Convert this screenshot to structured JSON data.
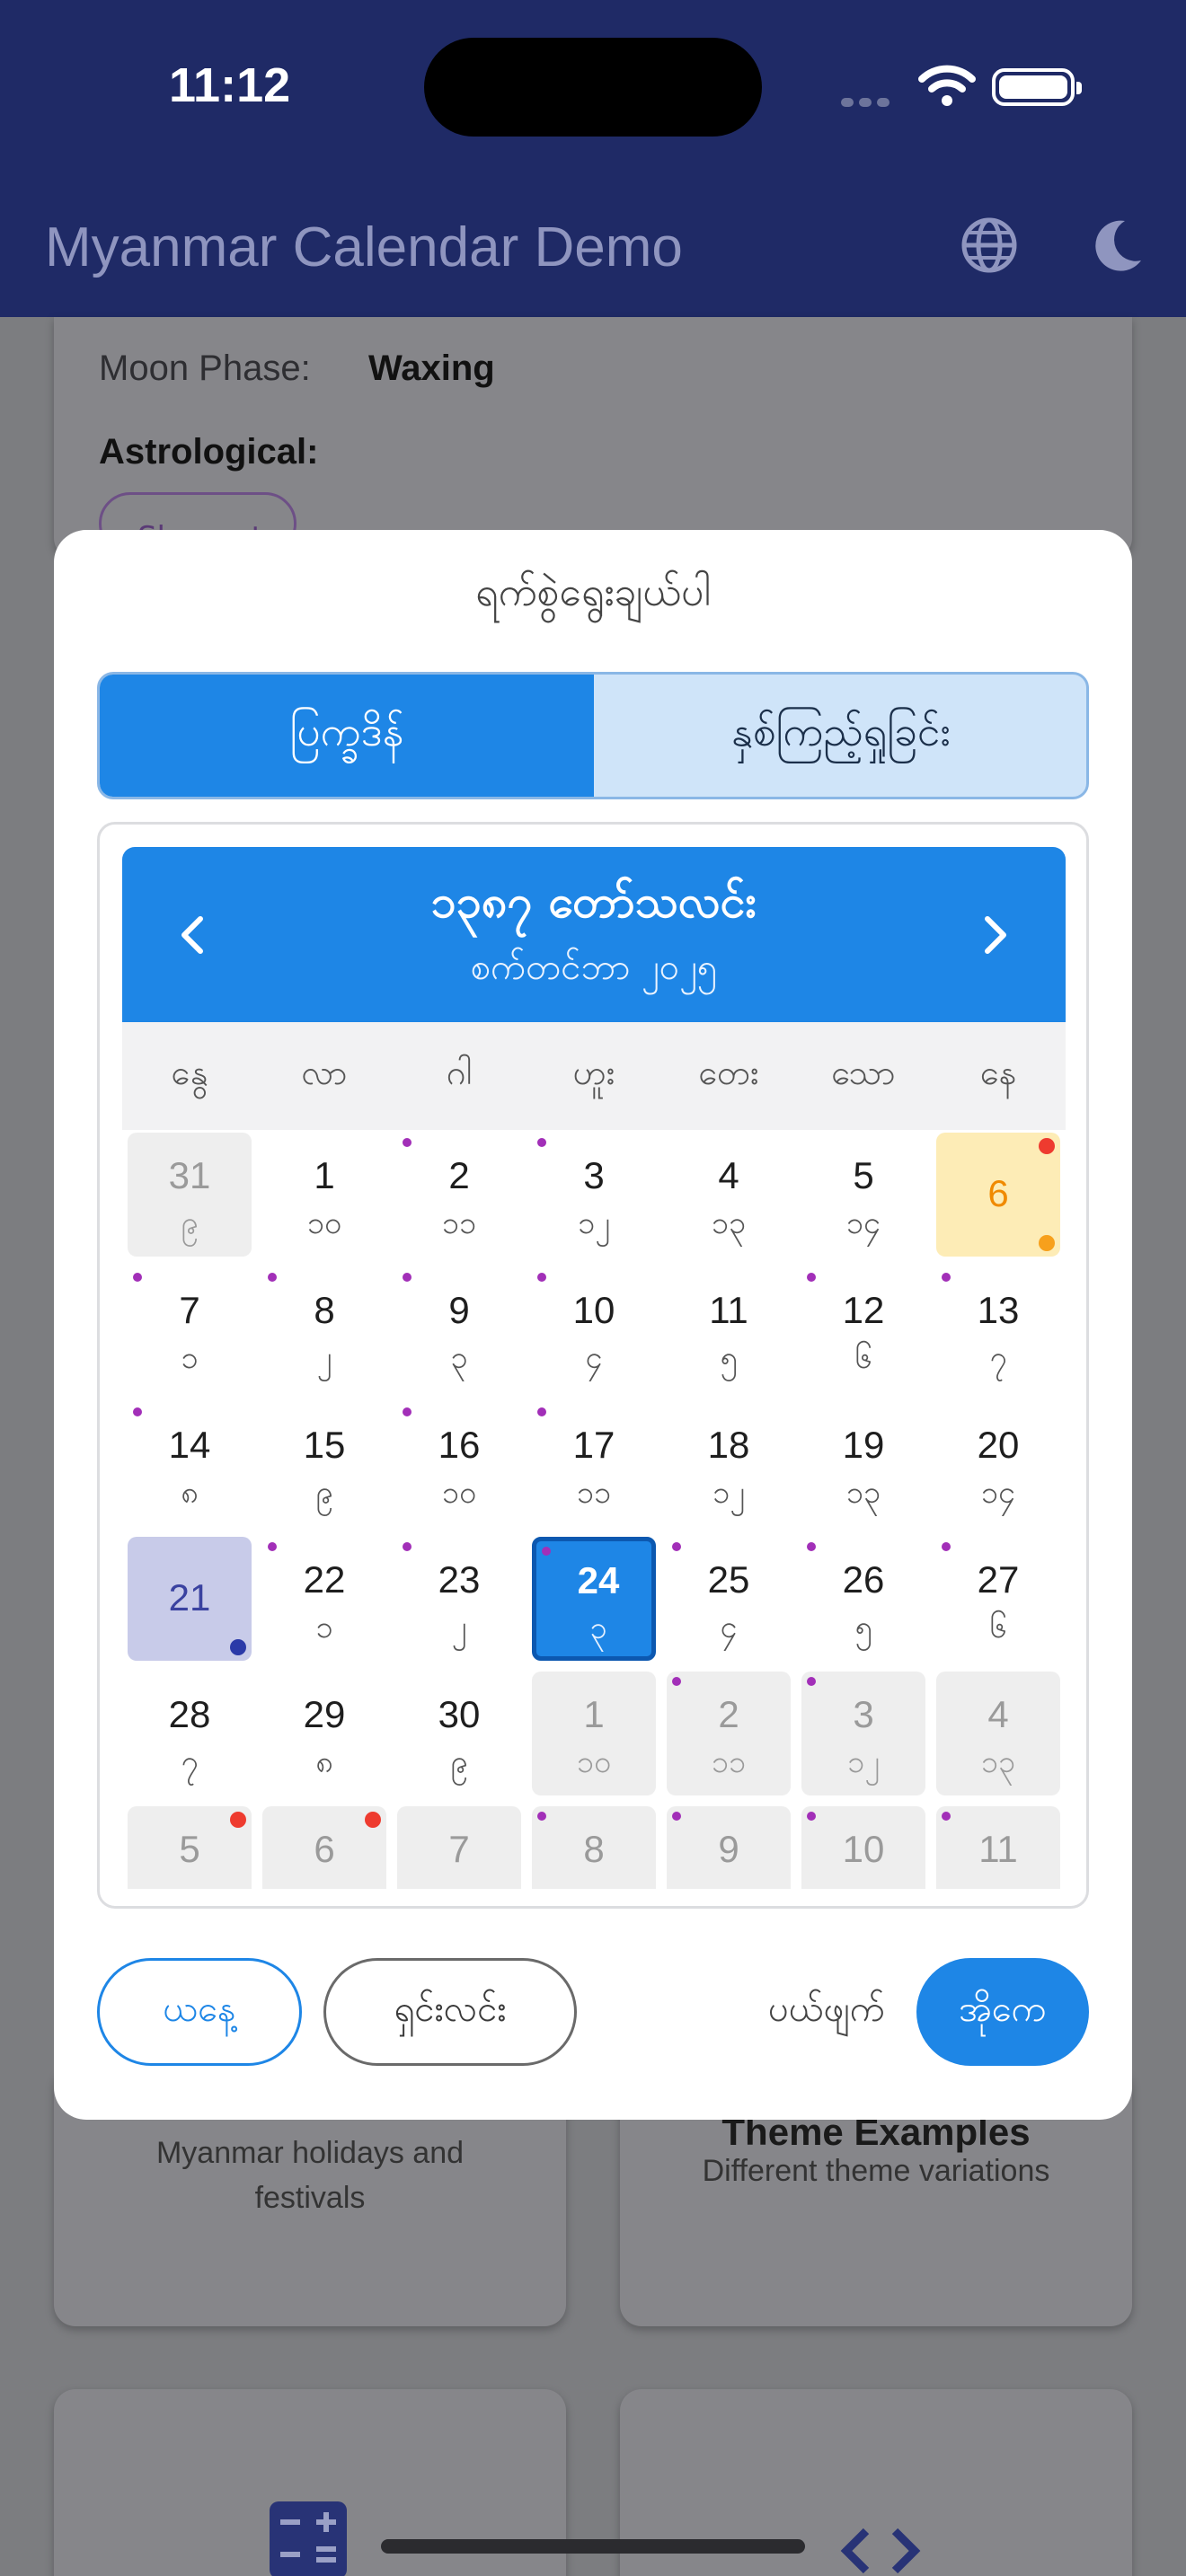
{
  "status_bar": {
    "time": "11:12"
  },
  "app_bar": {
    "title": "Myanmar Calendar Demo",
    "icons": [
      "globe-icon",
      "moon-icon"
    ]
  },
  "background": {
    "moon_phase_label": "Moon Phase:",
    "moon_phase_value": "Waxing",
    "astrological_label": "Astrological:",
    "chip": "Shanyat",
    "card_left_desc": "Myanmar holidays and festivals",
    "card_right_title": "Theme Examples",
    "card_right_desc": "Different theme variations"
  },
  "dialog": {
    "title": "ရက်စွဲရွေးချယ်ပါ",
    "tabs": [
      "ပြက္ခဒိန်",
      "နှစ်ကြည့်ရှုခြင်း"
    ],
    "header": {
      "myanmar_month": "၁၃၈၇ တော်သလင်း",
      "western_month": "စက်တင်ဘာ ၂၀၂၅"
    },
    "weekdays": [
      "နွေ",
      "လာ",
      "ဂါ",
      "ဟူး",
      "တေး",
      "သော",
      "နေ"
    ],
    "days": [
      {
        "g": "31",
        "m": "၉",
        "t": "other"
      },
      {
        "g": "1",
        "m": "၁၀",
        "t": "normal"
      },
      {
        "g": "2",
        "m": "၁၁",
        "t": "normal",
        "dot": true
      },
      {
        "g": "3",
        "m": "၁၂",
        "t": "normal",
        "dot": true
      },
      {
        "g": "4",
        "m": "၁၃",
        "t": "normal"
      },
      {
        "g": "5",
        "m": "၁၄",
        "t": "normal"
      },
      {
        "g": "6",
        "m": "",
        "t": "today",
        "red": true,
        "br": "#f7a01c"
      },
      {
        "g": "7",
        "m": "၁",
        "t": "normal",
        "dot": true
      },
      {
        "g": "8",
        "m": "၂",
        "t": "normal",
        "dot": true
      },
      {
        "g": "9",
        "m": "၃",
        "t": "normal",
        "dot": true
      },
      {
        "g": "10",
        "m": "၄",
        "t": "normal",
        "dot": true
      },
      {
        "g": "11",
        "m": "၅",
        "t": "normal"
      },
      {
        "g": "12",
        "m": "၆",
        "t": "normal",
        "dot": true
      },
      {
        "g": "13",
        "m": "၇",
        "t": "normal",
        "dot": true
      },
      {
        "g": "14",
        "m": "၈",
        "t": "normal",
        "dot": true
      },
      {
        "g": "15",
        "m": "၉",
        "t": "normal"
      },
      {
        "g": "16",
        "m": "၁၀",
        "t": "normal",
        "dot": true
      },
      {
        "g": "17",
        "m": "၁၁",
        "t": "normal",
        "dot": true
      },
      {
        "g": "18",
        "m": "၁၂",
        "t": "normal"
      },
      {
        "g": "19",
        "m": "၁၃",
        "t": "normal"
      },
      {
        "g": "20",
        "m": "၁၄",
        "t": "normal"
      },
      {
        "g": "21",
        "m": "",
        "t": "sunday",
        "br": "#2b3aa8"
      },
      {
        "g": "22",
        "m": "၁",
        "t": "normal",
        "dot": true
      },
      {
        "g": "23",
        "m": "၂",
        "t": "normal",
        "dot": true
      },
      {
        "g": "24",
        "m": "၃",
        "t": "selected",
        "dot": true
      },
      {
        "g": "25",
        "m": "၄",
        "t": "normal",
        "dot": true
      },
      {
        "g": "26",
        "m": "၅",
        "t": "normal",
        "dot": true
      },
      {
        "g": "27",
        "m": "၆",
        "t": "normal",
        "dot": true
      },
      {
        "g": "28",
        "m": "၇",
        "t": "normal"
      },
      {
        "g": "29",
        "m": "၈",
        "t": "normal"
      },
      {
        "g": "30",
        "m": "၉",
        "t": "normal"
      },
      {
        "g": "1",
        "m": "၁၀",
        "t": "other"
      },
      {
        "g": "2",
        "m": "၁၁",
        "t": "other",
        "dot": true
      },
      {
        "g": "3",
        "m": "၁၂",
        "t": "other",
        "dot": true
      },
      {
        "g": "4",
        "m": "၁၃",
        "t": "other"
      },
      {
        "g": "5",
        "m": "",
        "t": "other",
        "red": true
      },
      {
        "g": "6",
        "m": "",
        "t": "other",
        "red": true
      },
      {
        "g": "7",
        "m": "",
        "t": "other"
      },
      {
        "g": "8",
        "m": "",
        "t": "other",
        "dot": true
      },
      {
        "g": "9",
        "m": "",
        "t": "other",
        "dot": true
      },
      {
        "g": "10",
        "m": "",
        "t": "other",
        "dot": true
      },
      {
        "g": "11",
        "m": "",
        "t": "other",
        "dot": true
      }
    ],
    "buttons": {
      "today": "ယနေ့",
      "clear": "ရှင်းလင်း",
      "cancel": "ပယ်ဖျက်",
      "ok": "အိုကေ"
    }
  }
}
